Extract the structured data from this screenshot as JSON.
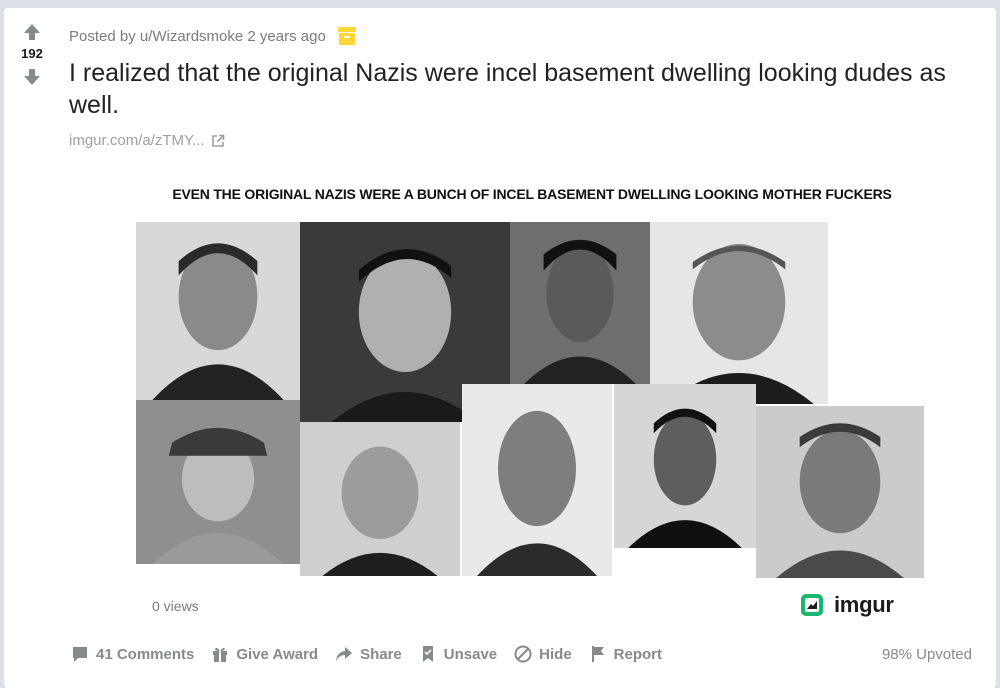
{
  "post": {
    "score": "192",
    "meta": "Posted by u/Wizardsmoke 2 years ago",
    "title": "I realized that the original Nazis were incel basement dwelling looking dudes as well.",
    "link_text": "imgur.com/a/zTMY...",
    "image_caption": "EVEN THE ORIGINAL NAZIS WERE A BUNCH OF INCEL BASEMENT DWELLING LOOKING MOTHER FUCKERS",
    "views": "0 views",
    "imgur_logo": "imgur"
  },
  "actions": {
    "comments": "41 Comments",
    "award": "Give Award",
    "share": "Share",
    "unsave": "Unsave",
    "hide": "Hide",
    "report": "Report"
  },
  "upvoted": "98% Upvoted",
  "icons": {
    "upvote": "arrow-up-icon",
    "downvote": "arrow-down-icon",
    "archived": "archive-icon",
    "external": "external-link-icon",
    "comments": "comment-icon",
    "award": "gift-icon",
    "share": "share-icon",
    "unsave": "bookmark-icon",
    "hide": "hide-icon",
    "report": "flag-icon",
    "imgur": "imgur-logo-icon"
  },
  "colors": {
    "archive_yellow": "#ffd635",
    "imgur_green": "#1bb76e",
    "meta_gray": "#787c7e",
    "action_gray": "#878a8c"
  }
}
